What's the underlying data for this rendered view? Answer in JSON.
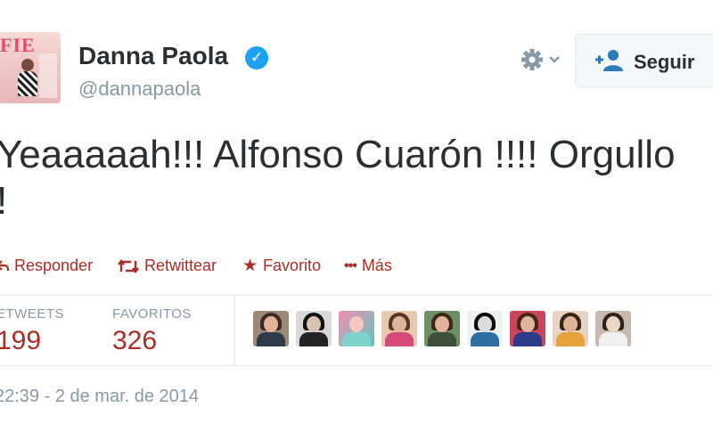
{
  "user": {
    "name": "Danna Paola",
    "handle": "@dannapaola",
    "avatar_text": "FIE"
  },
  "follow_button": {
    "label": "Seguir"
  },
  "tweet": {
    "line1": "Yeaaaaah!!! Alfonso Cuarón !!!! Orgullo",
    "line2": "!"
  },
  "actions": {
    "reply": "Responder",
    "retweet": "Retwittear",
    "favorite": "Favorito",
    "more": "Más"
  },
  "stats": {
    "retweets_label": "ETWEETS",
    "retweets_value": "199",
    "favorites_label": "FAVORITOS",
    "favorites_value": "326"
  },
  "timestamp": "22:39 - 2 de mar. de 2014",
  "colors": {
    "accent": "#aa2e26",
    "verified": "#1da1f2",
    "muted": "#8899a6",
    "text": "#292f33"
  },
  "icons": {
    "verified": "verified-badge-icon",
    "settings": "gear-icon",
    "follow": "follow-user-plus-icon",
    "reply": "reply-arrow-icon",
    "retweet": "retweet-icon",
    "favorite": "star-icon",
    "more": "ellipsis-icon"
  }
}
